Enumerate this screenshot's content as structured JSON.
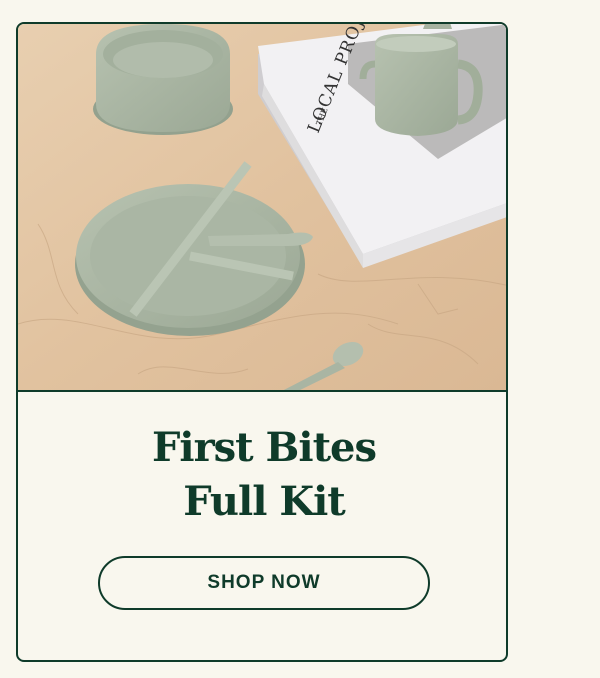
{
  "product": {
    "title_line1": "First Bites",
    "title_line2": "Full Kit",
    "cta_label": "SHOP NOW"
  },
  "photo": {
    "book_title": "LOCAL PROJECT",
    "book_small": "THE"
  },
  "colors": {
    "accent": "#0f3b2a",
    "background": "#f9f7ee",
    "sage": "#a9b5a3",
    "marble": "#e3c6a4"
  }
}
